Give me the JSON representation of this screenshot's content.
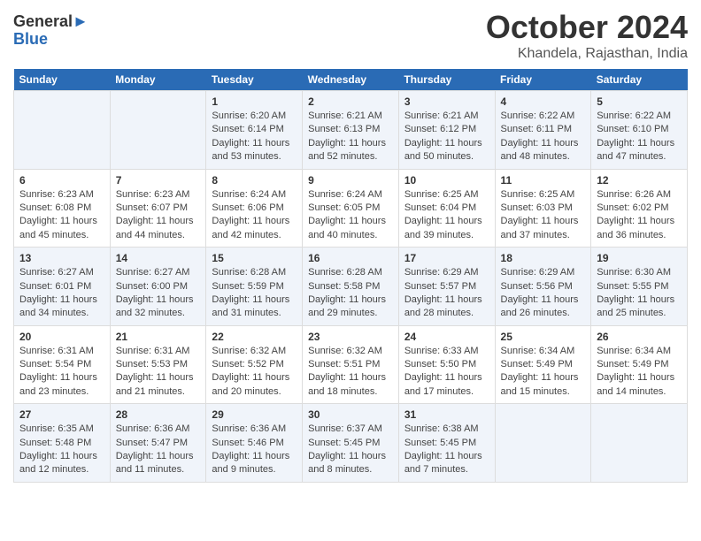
{
  "logo": {
    "general": "General",
    "blue": "Blue"
  },
  "title": "October 2024",
  "subtitle": "Khandela, Rajasthan, India",
  "days_header": [
    "Sunday",
    "Monday",
    "Tuesday",
    "Wednesday",
    "Thursday",
    "Friday",
    "Saturday"
  ],
  "weeks": [
    [
      {
        "num": "",
        "sunrise": "",
        "sunset": "",
        "daylight": ""
      },
      {
        "num": "",
        "sunrise": "",
        "sunset": "",
        "daylight": ""
      },
      {
        "num": "1",
        "sunrise": "Sunrise: 6:20 AM",
        "sunset": "Sunset: 6:14 PM",
        "daylight": "Daylight: 11 hours and 53 minutes."
      },
      {
        "num": "2",
        "sunrise": "Sunrise: 6:21 AM",
        "sunset": "Sunset: 6:13 PM",
        "daylight": "Daylight: 11 hours and 52 minutes."
      },
      {
        "num": "3",
        "sunrise": "Sunrise: 6:21 AM",
        "sunset": "Sunset: 6:12 PM",
        "daylight": "Daylight: 11 hours and 50 minutes."
      },
      {
        "num": "4",
        "sunrise": "Sunrise: 6:22 AM",
        "sunset": "Sunset: 6:11 PM",
        "daylight": "Daylight: 11 hours and 48 minutes."
      },
      {
        "num": "5",
        "sunrise": "Sunrise: 6:22 AM",
        "sunset": "Sunset: 6:10 PM",
        "daylight": "Daylight: 11 hours and 47 minutes."
      }
    ],
    [
      {
        "num": "6",
        "sunrise": "Sunrise: 6:23 AM",
        "sunset": "Sunset: 6:08 PM",
        "daylight": "Daylight: 11 hours and 45 minutes."
      },
      {
        "num": "7",
        "sunrise": "Sunrise: 6:23 AM",
        "sunset": "Sunset: 6:07 PM",
        "daylight": "Daylight: 11 hours and 44 minutes."
      },
      {
        "num": "8",
        "sunrise": "Sunrise: 6:24 AM",
        "sunset": "Sunset: 6:06 PM",
        "daylight": "Daylight: 11 hours and 42 minutes."
      },
      {
        "num": "9",
        "sunrise": "Sunrise: 6:24 AM",
        "sunset": "Sunset: 6:05 PM",
        "daylight": "Daylight: 11 hours and 40 minutes."
      },
      {
        "num": "10",
        "sunrise": "Sunrise: 6:25 AM",
        "sunset": "Sunset: 6:04 PM",
        "daylight": "Daylight: 11 hours and 39 minutes."
      },
      {
        "num": "11",
        "sunrise": "Sunrise: 6:25 AM",
        "sunset": "Sunset: 6:03 PM",
        "daylight": "Daylight: 11 hours and 37 minutes."
      },
      {
        "num": "12",
        "sunrise": "Sunrise: 6:26 AM",
        "sunset": "Sunset: 6:02 PM",
        "daylight": "Daylight: 11 hours and 36 minutes."
      }
    ],
    [
      {
        "num": "13",
        "sunrise": "Sunrise: 6:27 AM",
        "sunset": "Sunset: 6:01 PM",
        "daylight": "Daylight: 11 hours and 34 minutes."
      },
      {
        "num": "14",
        "sunrise": "Sunrise: 6:27 AM",
        "sunset": "Sunset: 6:00 PM",
        "daylight": "Daylight: 11 hours and 32 minutes."
      },
      {
        "num": "15",
        "sunrise": "Sunrise: 6:28 AM",
        "sunset": "Sunset: 5:59 PM",
        "daylight": "Daylight: 11 hours and 31 minutes."
      },
      {
        "num": "16",
        "sunrise": "Sunrise: 6:28 AM",
        "sunset": "Sunset: 5:58 PM",
        "daylight": "Daylight: 11 hours and 29 minutes."
      },
      {
        "num": "17",
        "sunrise": "Sunrise: 6:29 AM",
        "sunset": "Sunset: 5:57 PM",
        "daylight": "Daylight: 11 hours and 28 minutes."
      },
      {
        "num": "18",
        "sunrise": "Sunrise: 6:29 AM",
        "sunset": "Sunset: 5:56 PM",
        "daylight": "Daylight: 11 hours and 26 minutes."
      },
      {
        "num": "19",
        "sunrise": "Sunrise: 6:30 AM",
        "sunset": "Sunset: 5:55 PM",
        "daylight": "Daylight: 11 hours and 25 minutes."
      }
    ],
    [
      {
        "num": "20",
        "sunrise": "Sunrise: 6:31 AM",
        "sunset": "Sunset: 5:54 PM",
        "daylight": "Daylight: 11 hours and 23 minutes."
      },
      {
        "num": "21",
        "sunrise": "Sunrise: 6:31 AM",
        "sunset": "Sunset: 5:53 PM",
        "daylight": "Daylight: 11 hours and 21 minutes."
      },
      {
        "num": "22",
        "sunrise": "Sunrise: 6:32 AM",
        "sunset": "Sunset: 5:52 PM",
        "daylight": "Daylight: 11 hours and 20 minutes."
      },
      {
        "num": "23",
        "sunrise": "Sunrise: 6:32 AM",
        "sunset": "Sunset: 5:51 PM",
        "daylight": "Daylight: 11 hours and 18 minutes."
      },
      {
        "num": "24",
        "sunrise": "Sunrise: 6:33 AM",
        "sunset": "Sunset: 5:50 PM",
        "daylight": "Daylight: 11 hours and 17 minutes."
      },
      {
        "num": "25",
        "sunrise": "Sunrise: 6:34 AM",
        "sunset": "Sunset: 5:49 PM",
        "daylight": "Daylight: 11 hours and 15 minutes."
      },
      {
        "num": "26",
        "sunrise": "Sunrise: 6:34 AM",
        "sunset": "Sunset: 5:49 PM",
        "daylight": "Daylight: 11 hours and 14 minutes."
      }
    ],
    [
      {
        "num": "27",
        "sunrise": "Sunrise: 6:35 AM",
        "sunset": "Sunset: 5:48 PM",
        "daylight": "Daylight: 11 hours and 12 minutes."
      },
      {
        "num": "28",
        "sunrise": "Sunrise: 6:36 AM",
        "sunset": "Sunset: 5:47 PM",
        "daylight": "Daylight: 11 hours and 11 minutes."
      },
      {
        "num": "29",
        "sunrise": "Sunrise: 6:36 AM",
        "sunset": "Sunset: 5:46 PM",
        "daylight": "Daylight: 11 hours and 9 minutes."
      },
      {
        "num": "30",
        "sunrise": "Sunrise: 6:37 AM",
        "sunset": "Sunset: 5:45 PM",
        "daylight": "Daylight: 11 hours and 8 minutes."
      },
      {
        "num": "31",
        "sunrise": "Sunrise: 6:38 AM",
        "sunset": "Sunset: 5:45 PM",
        "daylight": "Daylight: 11 hours and 7 minutes."
      },
      {
        "num": "",
        "sunrise": "",
        "sunset": "",
        "daylight": ""
      },
      {
        "num": "",
        "sunrise": "",
        "sunset": "",
        "daylight": ""
      }
    ]
  ]
}
